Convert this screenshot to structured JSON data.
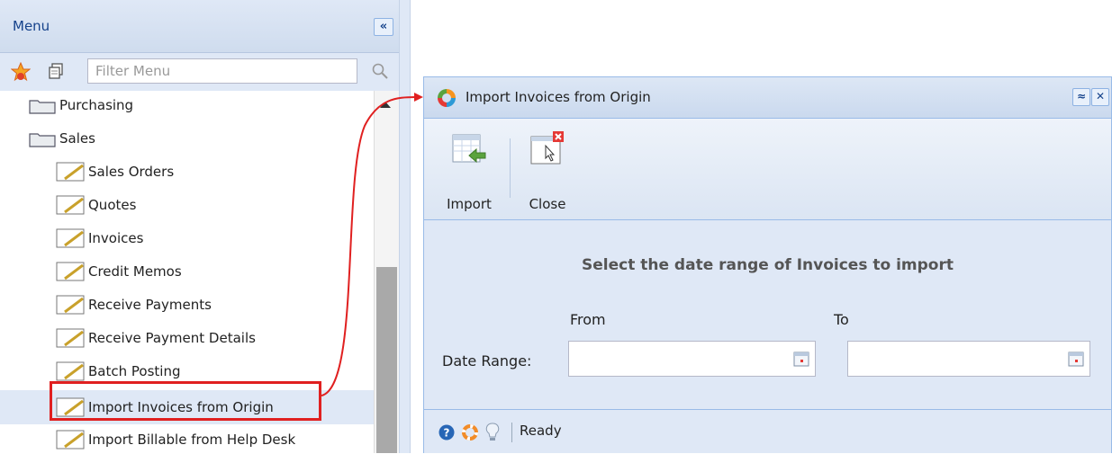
{
  "menu": {
    "title": "Menu",
    "collapse_glyph": "«",
    "filter_placeholder": "Filter Menu",
    "tree": [
      {
        "label": "Purchasing",
        "type": "folder"
      },
      {
        "label": "Sales",
        "type": "folder"
      },
      {
        "label": "Sales Orders",
        "type": "screen"
      },
      {
        "label": "Quotes",
        "type": "screen"
      },
      {
        "label": "Invoices",
        "type": "screen"
      },
      {
        "label": "Credit Memos",
        "type": "screen"
      },
      {
        "label": "Receive Payments",
        "type": "screen"
      },
      {
        "label": "Receive Payment Details",
        "type": "screen"
      },
      {
        "label": "Batch Posting",
        "type": "screen"
      },
      {
        "label": "Import Invoices from Origin",
        "type": "screen",
        "selected": true
      },
      {
        "label": "Import Billable from Help Desk",
        "type": "screen"
      }
    ]
  },
  "dialog": {
    "title": "Import Invoices from Origin",
    "maximize_glyph": "≈",
    "close_glyph": "✕",
    "toolbar": {
      "import_label": "Import",
      "close_label": "Close"
    },
    "prompt": "Select the date range of Invoices to import",
    "from_label": "From",
    "to_label": "To",
    "date_range_label": "Date Range:",
    "from_value": "",
    "to_value": ""
  },
  "status": {
    "text": "Ready"
  },
  "colors": {
    "panel": "#dfe8f6",
    "border": "#99bbe8",
    "highlight": "#e02020"
  }
}
